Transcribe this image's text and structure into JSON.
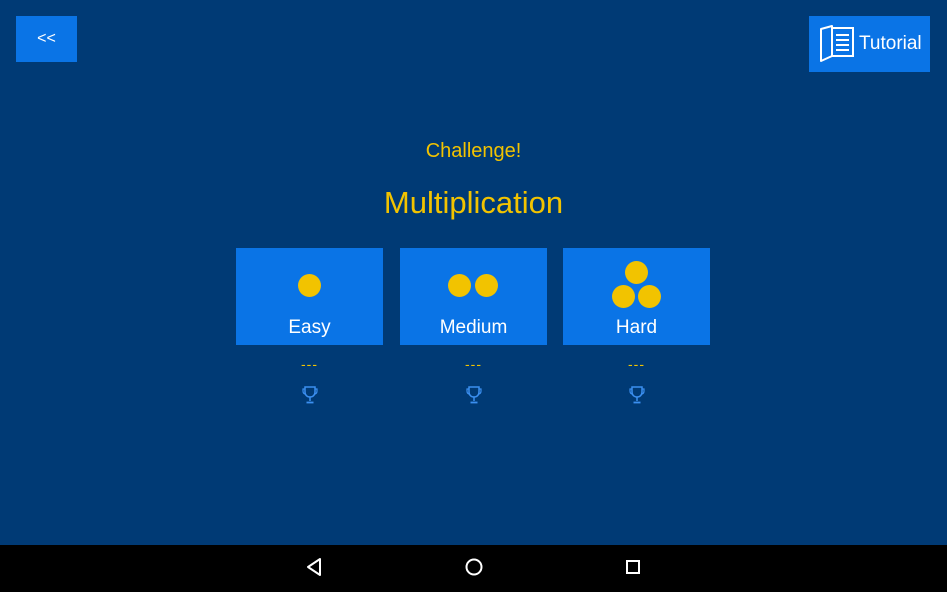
{
  "toolbar": {
    "back_label": "<<",
    "tutorial_label": "Tutorial",
    "tutorial_icon": "book-icon"
  },
  "header": {
    "challenge": "Challenge!",
    "topic": "Multiplication"
  },
  "levels": [
    {
      "label": "Easy",
      "dots": 1,
      "score": "---",
      "icon": "trophy-icon"
    },
    {
      "label": "Medium",
      "dots": 2,
      "score": "---",
      "icon": "trophy-icon"
    },
    {
      "label": "Hard",
      "dots": 3,
      "score": "---",
      "icon": "trophy-icon"
    }
  ],
  "navbar": {
    "back_icon": "triangle-back-icon",
    "home_icon": "circle-home-icon",
    "recents_icon": "square-recents-icon"
  },
  "colors": {
    "background": "#003a75",
    "button": "#0a74e6",
    "accent": "#f2c300",
    "trophy": "#3b8ff0"
  }
}
